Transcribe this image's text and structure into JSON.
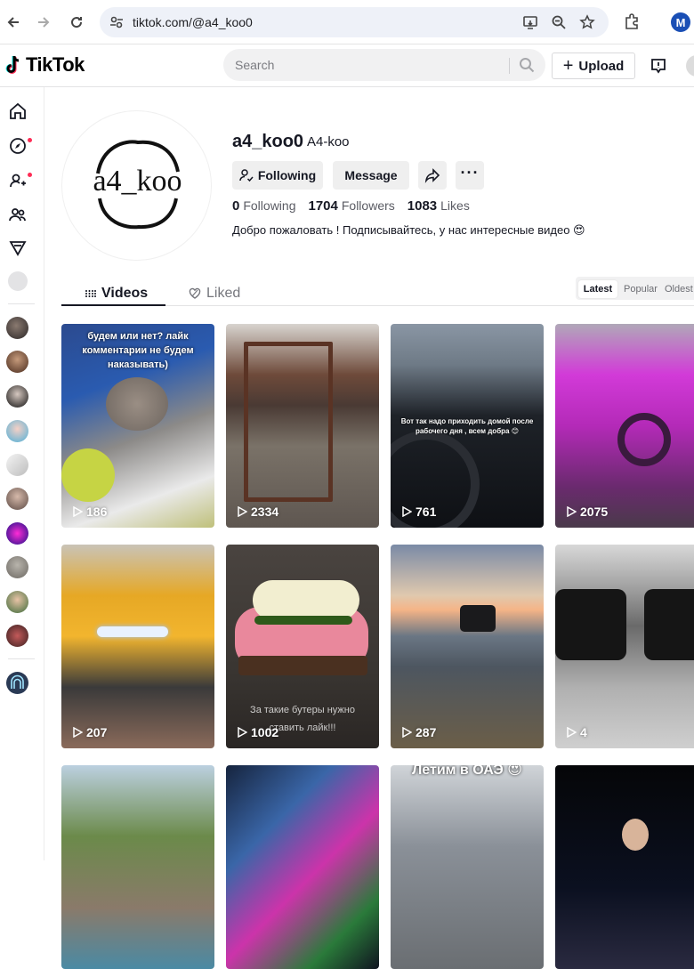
{
  "browser": {
    "url": "tiktok.com/@a4_koo0",
    "profile_initial": "M"
  },
  "header": {
    "logo": "TikTok",
    "search_placeholder": "Search",
    "upload_label": "Upload"
  },
  "profile": {
    "avatar_text": "a4_koo",
    "username": "a4_koo0",
    "nickname": "A4-koo",
    "following_button": "Following",
    "message_button": "Message",
    "following_count": "0",
    "following_label": "Following",
    "followers_count": "1704",
    "followers_label": "Followers",
    "likes_count": "1083",
    "likes_label": "Likes",
    "bio": "Добро пожаловать ! Подписывайтесь, у нас интересные видео 😍"
  },
  "tabs": {
    "videos": "Videos",
    "liked": "Liked"
  },
  "sort": {
    "latest": "Latest",
    "popular": "Popular",
    "oldest": "Oldest"
  },
  "videos": [
    {
      "views": "186",
      "caption": "будем или нет? лайк комментарии не будем наказывать)"
    },
    {
      "views": "2334",
      "caption": ""
    },
    {
      "views": "761",
      "caption": "Вот так надо приходить домой после рабочего дня , всем добра 😊"
    },
    {
      "views": "2075",
      "caption": ""
    },
    {
      "views": "207",
      "caption": ""
    },
    {
      "views": "1002",
      "caption": "За такие бутеры нужно ставить лайк!!!"
    },
    {
      "views": "287",
      "caption": ""
    },
    {
      "views": "4",
      "caption": ""
    },
    {
      "views": "",
      "caption": ""
    },
    {
      "views": "",
      "caption": ""
    },
    {
      "views": "",
      "caption": "Летим в ОАЭ 😍"
    },
    {
      "views": "",
      "caption": ""
    }
  ],
  "colors": {
    "accent": "#fe2c55",
    "text": "#161823",
    "button_bg": "#efefef"
  }
}
